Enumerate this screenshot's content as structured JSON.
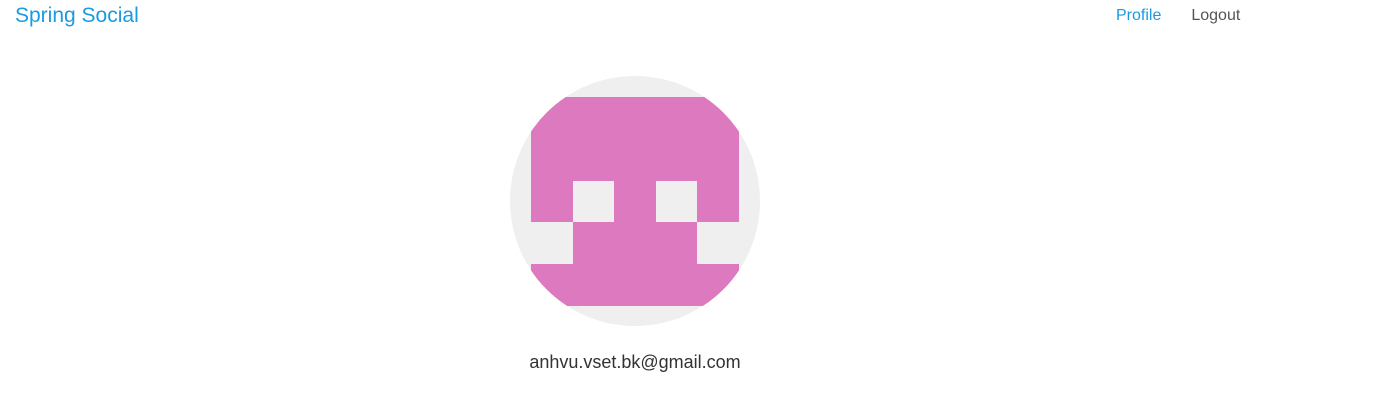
{
  "header": {
    "title": "Spring Social",
    "nav": {
      "profile_label": "Profile",
      "logout_label": "Logout"
    }
  },
  "profile": {
    "avatar_icon": "identicon-avatar",
    "email": "anhvu.vset.bk@gmail.com"
  },
  "colors": {
    "brand": "#1a9ae0",
    "nav_text": "#555555",
    "avatar_background": "#f0eff0",
    "avatar_pattern": "#dc79bf"
  }
}
